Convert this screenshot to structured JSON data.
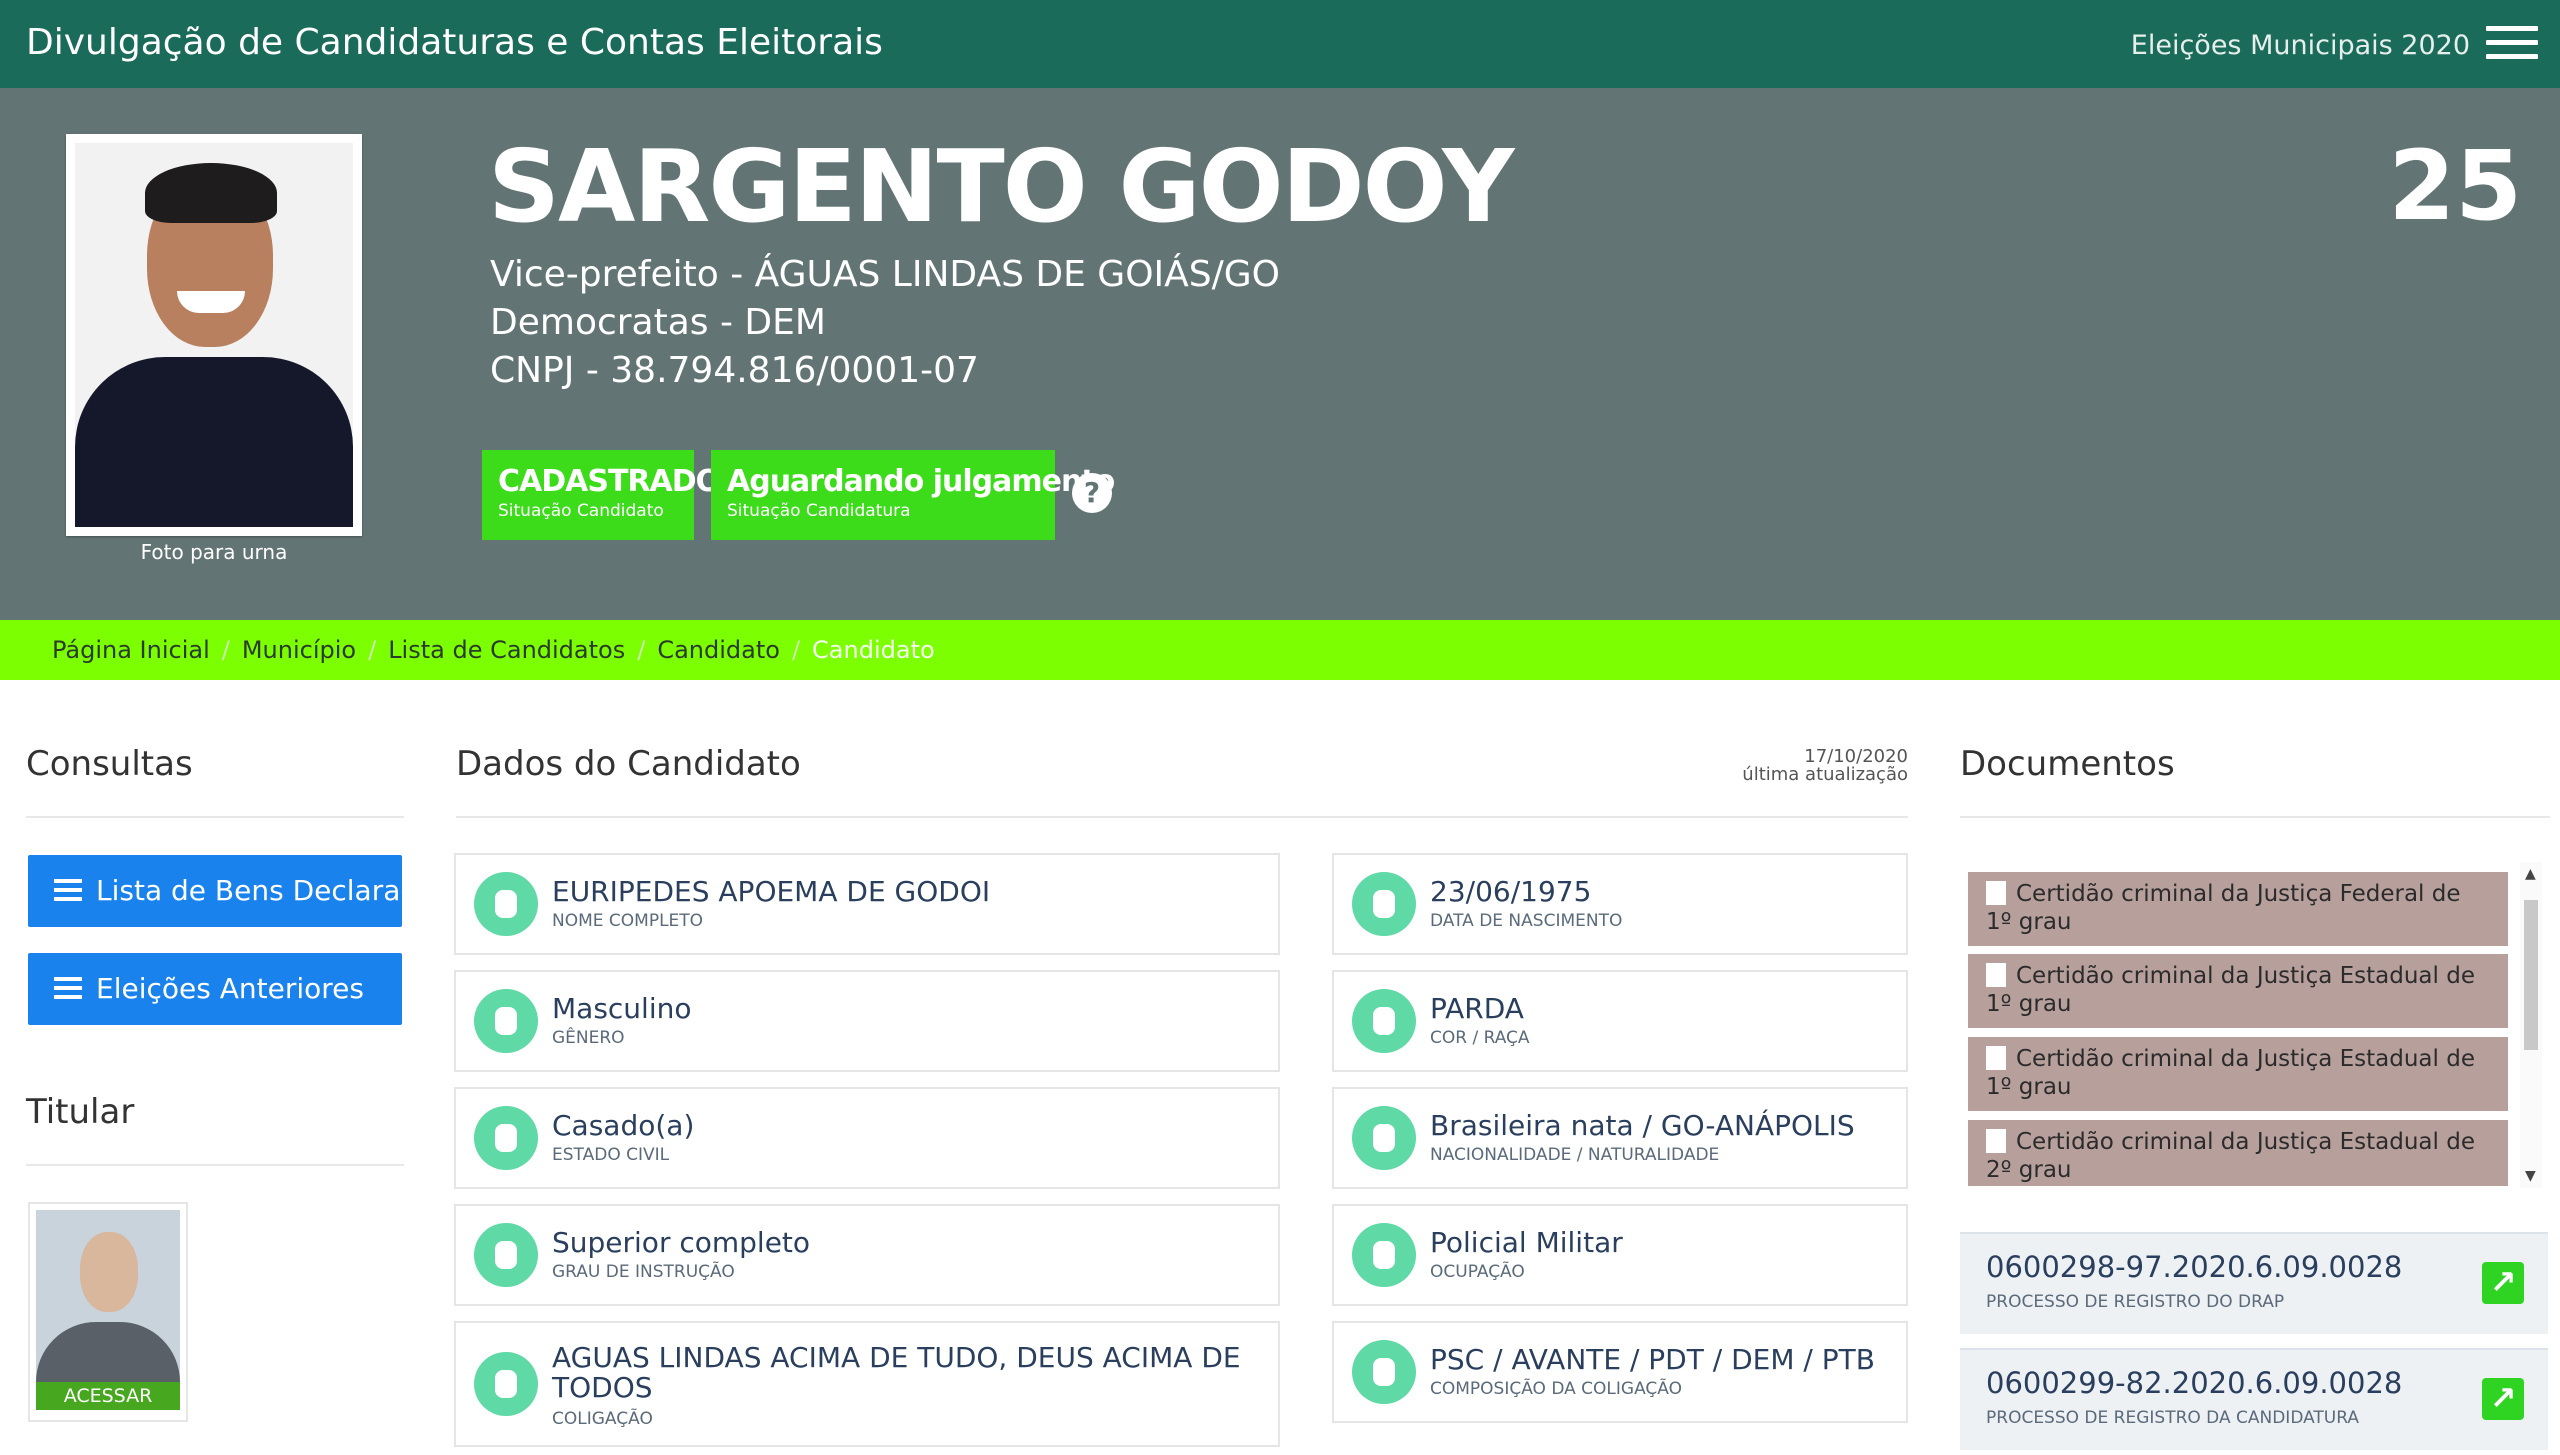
{
  "header": {
    "app_title": "Divulgação de Candidaturas e Contas Eleitorais",
    "election": "Eleições Municipais 2020"
  },
  "candidate": {
    "name": "SARGENTO GODOY",
    "number": "25",
    "office": "Vice-prefeito - ÁGUAS LINDAS DE GOIÁS/GO",
    "party": "Democratas - DEM",
    "cnpj": "CNPJ - 38.794.816/0001-07",
    "photo_caption": "Foto para urna",
    "status_candidate": {
      "value": "CADASTRADO",
      "label": "Situação Candidato"
    },
    "status_candidacy": {
      "value": "Aguardando julgamento",
      "label": "Situação Candidatura"
    },
    "help": "?"
  },
  "breadcrumb": [
    "Página Inicial",
    "Município",
    "Lista de Candidatos",
    "Candidato",
    "Candidato"
  ],
  "consultas": {
    "title": "Consultas",
    "buttons": [
      "Lista de Bens Declarados",
      "Eleições Anteriores"
    ]
  },
  "titular": {
    "title": "Titular",
    "button": "ACESSAR"
  },
  "dados": {
    "title": "Dados do Candidato",
    "updated_date": "17/10/2020",
    "updated_label": "última atualização",
    "left": [
      {
        "value": "EURIPEDES APOEMA DE GODOI",
        "label": "NOME COMPLETO"
      },
      {
        "value": "Masculino",
        "label": "GÊNERO"
      },
      {
        "value": "Casado(a)",
        "label": "ESTADO CIVIL"
      },
      {
        "value": "Superior completo",
        "label": "GRAU DE INSTRUÇÃO"
      },
      {
        "value": "AGUAS LINDAS ACIMA DE TUDO, DEUS ACIMA DE TODOS",
        "label": "COLIGAÇÃO"
      }
    ],
    "right": [
      {
        "value": "23/06/1975",
        "label": "DATA DE NASCIMENTO"
      },
      {
        "value": "PARDA",
        "label": "COR / RAÇA"
      },
      {
        "value": "Brasileira nata / GO-ANÁPOLIS",
        "label": "NACIONALIDADE / NATURALIDADE"
      },
      {
        "value": "Policial Militar",
        "label": "OCUPAÇÃO"
      },
      {
        "value": "PSC / AVANTE / PDT / DEM / PTB",
        "label": "COMPOSIÇÃO DA COLIGAÇÃO"
      }
    ]
  },
  "documentos": {
    "title": "Documentos",
    "items": [
      "Certidão criminal da Justiça Federal de 1º grau",
      "Certidão criminal da Justiça Estadual de 1º grau",
      "Certidão criminal da Justiça Estadual de 1º grau",
      "Certidão criminal da Justiça Estadual de 2º grau"
    ],
    "processes": [
      {
        "number": "0600298-97.2020.6.09.0028",
        "label": "PROCESSO DE REGISTRO DO DRAP"
      },
      {
        "number": "0600299-82.2020.6.09.0028",
        "label": "PROCESSO DE REGISTRO DA CANDIDATURA"
      }
    ]
  },
  "colors": {
    "header": "#1b6b5a",
    "hero": "#637474",
    "status_green": "#3ddc1b",
    "breadcrumb": "#7cff00",
    "button_blue": "#1a82ec",
    "icon_mint": "#5fd9a6"
  },
  "icons": [
    "hamburger-menu-icon",
    "help-icon",
    "list-icon",
    "user-icon",
    "calendar-icon",
    "gender-icon",
    "body-icon",
    "ring-icon",
    "map-icon",
    "graduation-cap-icon",
    "bank-icon",
    "group-icon",
    "folder-icon",
    "file-icon",
    "external-link-icon"
  ]
}
